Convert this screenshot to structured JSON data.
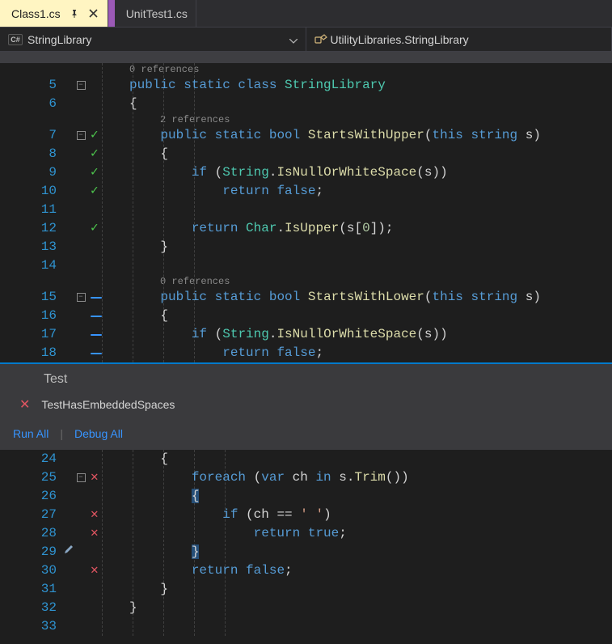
{
  "tabs": [
    {
      "label": "Class1.cs",
      "active": true,
      "pinned": true
    },
    {
      "label": "UnitTest1.cs",
      "active": false,
      "pinned": false
    }
  ],
  "navbar": {
    "left": "StringLibrary",
    "right": "UtilityLibraries.StringLibrary"
  },
  "popup": {
    "heading": "Test",
    "item": "TestHasEmbeddedSpaces",
    "run_all": "Run All",
    "debug_all": "Debug All"
  },
  "references": {
    "zero": "0 references",
    "two": "2 references"
  },
  "code_top": [
    {
      "n": "5",
      "fold": true,
      "status": "",
      "tokens": [
        [
          "public ",
          "kw"
        ],
        [
          "static class ",
          "kw"
        ],
        [
          "StringLibrary",
          "type"
        ]
      ]
    },
    {
      "n": "6",
      "fold": false,
      "status": "",
      "tokens": [
        [
          "{",
          "plain"
        ]
      ]
    },
    {
      "n": "7",
      "fold": true,
      "status": "check",
      "tokens": [
        [
          "    public ",
          "kw"
        ],
        [
          "static ",
          "kw"
        ],
        [
          "bool ",
          "kw"
        ],
        [
          "StartsWithUpper",
          "method"
        ],
        [
          "(",
          "paren"
        ],
        [
          "this ",
          "kw"
        ],
        [
          "string ",
          "kw"
        ],
        [
          "s",
          "plain"
        ],
        [
          ")",
          "paren"
        ]
      ]
    },
    {
      "n": "8",
      "fold": false,
      "status": "check",
      "tokens": [
        [
          "    {",
          "plain"
        ]
      ]
    },
    {
      "n": "9",
      "fold": false,
      "status": "check",
      "tokens": [
        [
          "        if ",
          "kw"
        ],
        [
          "(",
          "paren"
        ],
        [
          "String",
          "type"
        ],
        [
          ".",
          "plain"
        ],
        [
          "IsNullOrWhiteSpace",
          "method"
        ],
        [
          "(",
          "paren"
        ],
        [
          "s",
          "plain"
        ],
        [
          "))",
          "paren"
        ]
      ]
    },
    {
      "n": "10",
      "fold": false,
      "status": "check",
      "tokens": [
        [
          "            return ",
          "kw"
        ],
        [
          "false",
          "kw"
        ],
        [
          ";",
          "plain"
        ]
      ]
    },
    {
      "n": "11",
      "fold": false,
      "status": "",
      "tokens": [
        [
          "",
          "plain"
        ]
      ]
    },
    {
      "n": "12",
      "fold": false,
      "status": "check",
      "tokens": [
        [
          "        return ",
          "kw"
        ],
        [
          "Char",
          "type"
        ],
        [
          ".",
          "plain"
        ],
        [
          "IsUpper",
          "method"
        ],
        [
          "(",
          "paren"
        ],
        [
          "s",
          "plain"
        ],
        [
          "[",
          "plain"
        ],
        [
          "0",
          "num"
        ],
        [
          "]);",
          "plain"
        ]
      ]
    },
    {
      "n": "13",
      "fold": false,
      "status": "",
      "tokens": [
        [
          "    }",
          "plain"
        ]
      ]
    },
    {
      "n": "14",
      "fold": false,
      "status": "",
      "tokens": [
        [
          "",
          "plain"
        ]
      ]
    },
    {
      "n": "15",
      "fold": true,
      "status": "bar",
      "tokens": [
        [
          "    public ",
          "kw"
        ],
        [
          "static ",
          "kw"
        ],
        [
          "bool ",
          "kw"
        ],
        [
          "StartsWithLower",
          "method"
        ],
        [
          "(",
          "paren"
        ],
        [
          "this ",
          "kw"
        ],
        [
          "string ",
          "kw"
        ],
        [
          "s",
          "plain"
        ],
        [
          ")",
          "paren"
        ]
      ]
    },
    {
      "n": "16",
      "fold": false,
      "status": "bar",
      "tokens": [
        [
          "    {",
          "plain"
        ]
      ]
    },
    {
      "n": "17",
      "fold": false,
      "status": "bar",
      "tokens": [
        [
          "        if ",
          "kw"
        ],
        [
          "(",
          "paren"
        ],
        [
          "String",
          "type"
        ],
        [
          ".",
          "plain"
        ],
        [
          "IsNullOrWhiteSpace",
          "method"
        ],
        [
          "(",
          "paren"
        ],
        [
          "s",
          "plain"
        ],
        [
          "))",
          "paren"
        ]
      ]
    },
    {
      "n": "18",
      "fold": false,
      "status": "bar",
      "tokens": [
        [
          "            return ",
          "kw"
        ],
        [
          "false",
          "kw"
        ],
        [
          ";",
          "plain"
        ]
      ]
    }
  ],
  "code_bottom": [
    {
      "n": "24",
      "fold": false,
      "status": "",
      "pen": false,
      "tokens": [
        [
          "    {",
          "plain"
        ]
      ]
    },
    {
      "n": "25",
      "fold": true,
      "status": "x",
      "pen": false,
      "tokens": [
        [
          "        foreach ",
          "kw"
        ],
        [
          "(",
          "paren"
        ],
        [
          "var ",
          "kw"
        ],
        [
          "ch",
          "plain"
        ],
        [
          " in ",
          "kw"
        ],
        [
          "s",
          "plain"
        ],
        [
          ".",
          "plain"
        ],
        [
          "Trim",
          "method"
        ],
        [
          "())",
          "paren"
        ]
      ]
    },
    {
      "n": "26",
      "fold": false,
      "status": "",
      "pen": false,
      "tokens": [
        [
          "        ",
          "plain"
        ],
        [
          "{",
          "plain",
          "sel"
        ]
      ]
    },
    {
      "n": "27",
      "fold": false,
      "status": "x",
      "pen": false,
      "tokens": [
        [
          "            if ",
          "kw"
        ],
        [
          "(",
          "paren"
        ],
        [
          "ch ",
          "plain"
        ],
        [
          "== ",
          "plain"
        ],
        [
          "' '",
          "str"
        ],
        [
          ")",
          "paren"
        ]
      ]
    },
    {
      "n": "28",
      "fold": false,
      "status": "x",
      "pen": false,
      "tokens": [
        [
          "                return ",
          "kw"
        ],
        [
          "true",
          "kw"
        ],
        [
          ";",
          "plain"
        ]
      ]
    },
    {
      "n": "29",
      "fold": false,
      "status": "",
      "pen": true,
      "hl": true,
      "tokens": [
        [
          "        ",
          "plain"
        ],
        [
          "}",
          "plain",
          "sel"
        ]
      ]
    },
    {
      "n": "30",
      "fold": false,
      "status": "x",
      "pen": false,
      "tokens": [
        [
          "        return ",
          "kw"
        ],
        [
          "false",
          "kw"
        ],
        [
          ";",
          "plain"
        ]
      ]
    },
    {
      "n": "31",
      "fold": false,
      "status": "",
      "pen": false,
      "tokens": [
        [
          "    }",
          "plain"
        ]
      ]
    },
    {
      "n": "32",
      "fold": false,
      "status": "",
      "pen": false,
      "tokens": [
        [
          "}",
          "plain"
        ]
      ]
    },
    {
      "n": "33",
      "fold": false,
      "status": "",
      "pen": false,
      "tokens": [
        [
          "",
          "plain"
        ]
      ]
    }
  ]
}
